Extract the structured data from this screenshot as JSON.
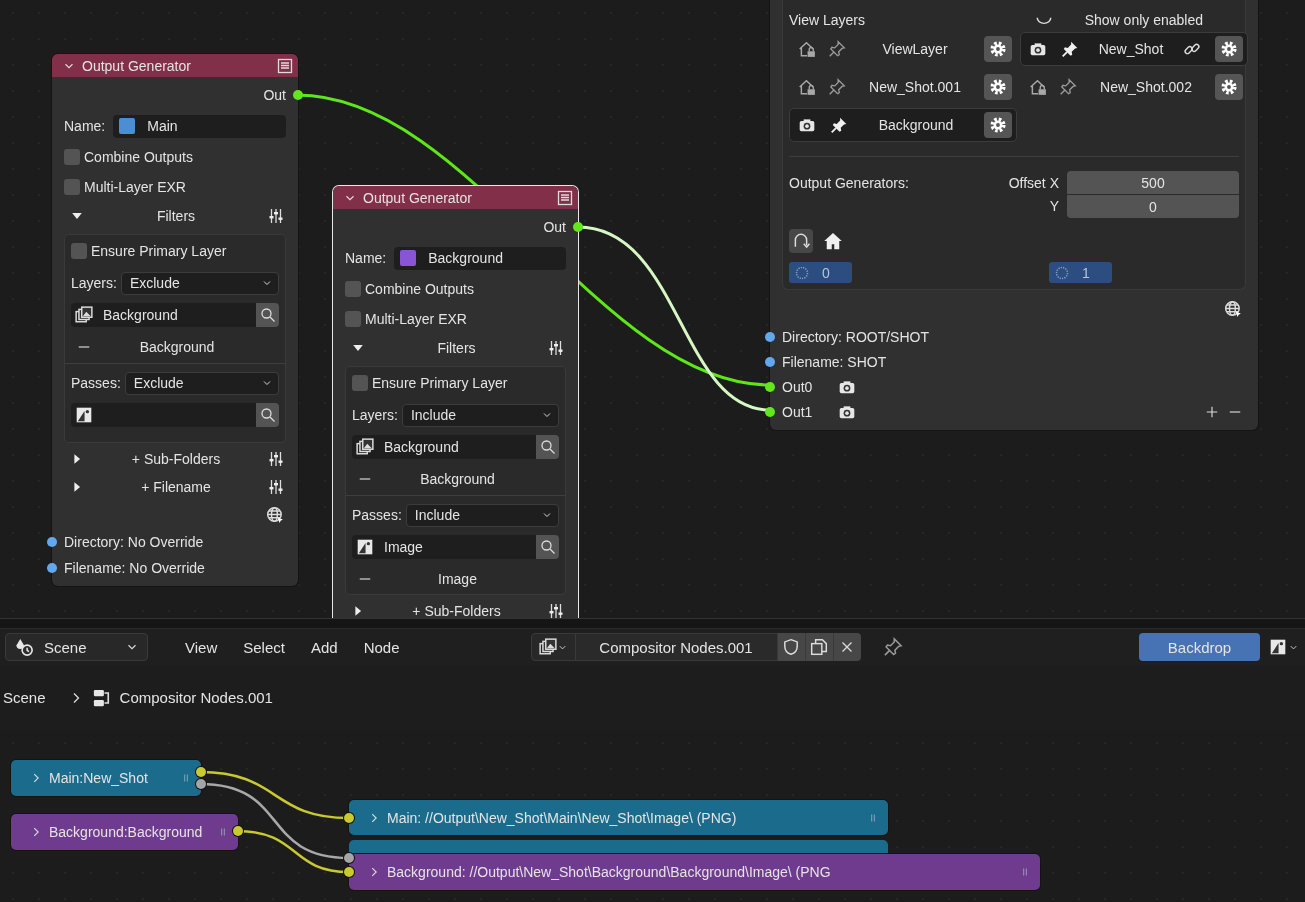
{
  "node_canvas": {
    "generators": [
      {
        "title": "Output Generator",
        "selected": false,
        "output": "Out",
        "name_label": "Name:",
        "name": "Main",
        "color": "#4a8fd6",
        "options": [
          {
            "label": "Combine Outputs",
            "checked": false
          },
          {
            "label": "Multi-Layer EXR",
            "checked": false
          }
        ],
        "filters": {
          "label": "Filters",
          "expanded": true,
          "ensure": {
            "label": "Ensure Primary Layer",
            "checked": false
          },
          "groups": [
            {
              "kind": "layers",
              "label": "Layers:",
              "mode": "Exclude",
              "search": "Background",
              "items": [
                "Background"
              ]
            },
            {
              "kind": "passes",
              "label": "Passes:",
              "mode": "Exclude"
            }
          ]
        },
        "sections": [
          {
            "label": "+ Sub-Folders",
            "expanded": false
          },
          {
            "label": "+ Filename",
            "expanded": false
          }
        ],
        "inputs": [
          "Directory: No Override",
          "Filename: No Override"
        ]
      },
      {
        "title": "Output Generator",
        "selected": true,
        "output": "Out",
        "name_label": "Name:",
        "name": "Background",
        "color": "#8a55d4",
        "options": [
          {
            "label": "Combine Outputs",
            "checked": false
          },
          {
            "label": "Multi-Layer EXR",
            "checked": false
          }
        ],
        "filters": {
          "label": "Filters",
          "expanded": true,
          "ensure": {
            "label": "Ensure Primary Layer",
            "checked": false
          },
          "groups": [
            {
              "kind": "layers",
              "label": "Layers:",
              "mode": "Include",
              "search": "Background",
              "items": [
                "Background"
              ]
            },
            {
              "kind": "passes",
              "label": "Passes:",
              "mode": "Include",
              "search": "Image",
              "items": [
                "Image"
              ]
            }
          ]
        },
        "sections": [
          {
            "label": "+ Sub-Folders",
            "expanded": false
          }
        ]
      }
    ],
    "output_node": {
      "view_layers": {
        "title": "View Layers",
        "filter_label": "Show only enabled",
        "layers": [
          {
            "name": "ViewLayer",
            "active": false,
            "linked": false
          },
          {
            "name": "New_Shot",
            "active": true,
            "linked": true
          },
          {
            "name": "New_Shot.001",
            "active": false,
            "linked": false
          },
          {
            "name": "New_Shot.002",
            "active": false,
            "linked": false
          },
          {
            "name": "Background",
            "active": true,
            "linked": false
          }
        ]
      },
      "generators_label": "Output Generators:",
      "offset": [
        {
          "label": "Offset X",
          "value": "500"
        },
        {
          "label": "Y",
          "value": "0"
        }
      ],
      "slots": [
        "0",
        "1"
      ],
      "inputs": [
        {
          "kind": "path",
          "label": "Directory: ROOT/SHOT"
        },
        {
          "kind": "path",
          "label": "Filename: SHOT"
        },
        {
          "kind": "image",
          "label": "Out0"
        },
        {
          "kind": "image",
          "label": "Out1"
        }
      ]
    }
  },
  "header": {
    "editor": "Scene",
    "menus": [
      "View",
      "Select",
      "Add",
      "Node"
    ],
    "node_tree": "Compositor Nodes.001",
    "backdrop": {
      "label": "Backdrop",
      "selected": true
    }
  },
  "breadcrumb": [
    "Scene",
    "Compositor Nodes.001"
  ],
  "group_canvas": {
    "inputs": [
      {
        "label": "Main:New_Shot",
        "color": "#1b6c8c"
      },
      {
        "label": "Background:Background",
        "color": "#6e3b8e"
      }
    ],
    "outputs": [
      {
        "label": "Main: //Output\\New_Shot\\Main\\New_Shot\\Image\\ (PNG)",
        "color": "#1b6c8c"
      },
      {
        "color": "#1b6c8c"
      },
      {
        "label": "Background: //Output\\New_Shot\\Background\\Background\\Image\\ (PNG",
        "color": "#6e3b8e"
      }
    ]
  }
}
